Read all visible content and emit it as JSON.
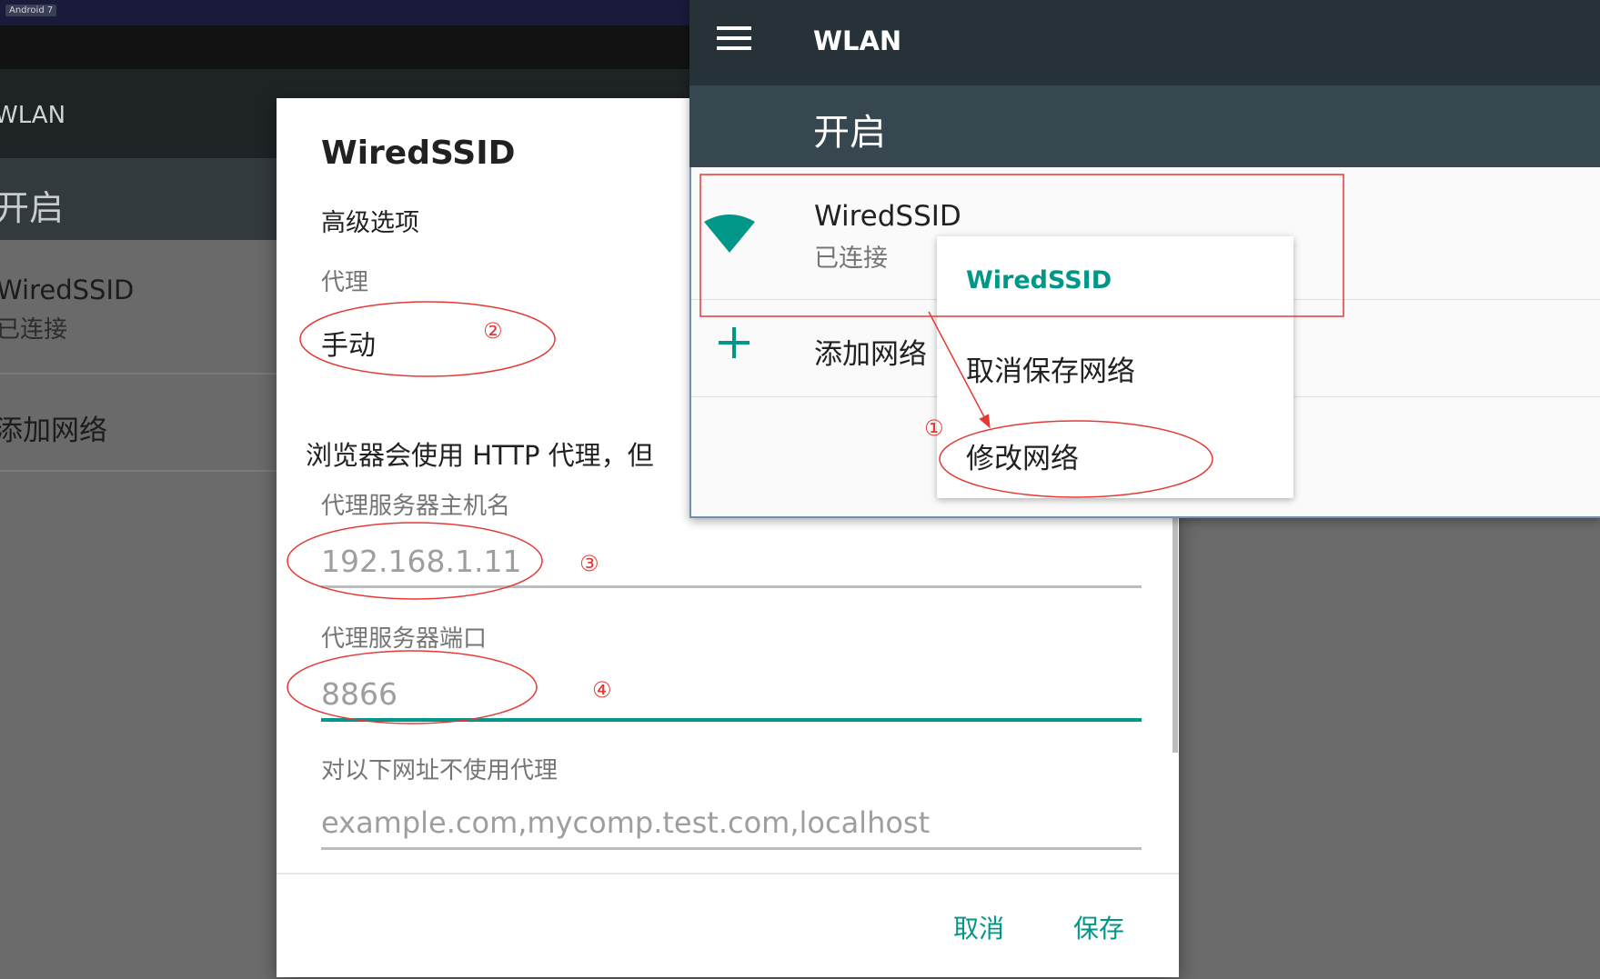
{
  "system": {
    "os_tag": "Android 7"
  },
  "background_screen": {
    "toolbar_title": "WLAN",
    "switch_label": "开启",
    "network": {
      "ssid": "WiredSSID",
      "status": "已连接"
    },
    "add_network_label": "添加网络"
  },
  "dialog": {
    "title": "WiredSSID",
    "advanced_options_label": "高级选项",
    "proxy": {
      "label": "代理",
      "value": "手动"
    },
    "warning_text": "浏览器会使用 HTTP 代理，但",
    "hostname": {
      "label": "代理服务器主机名",
      "placeholder": "192.168.1.11"
    },
    "port": {
      "label": "代理服务器端口",
      "placeholder": "8866"
    },
    "bypass": {
      "label": "对以下网址不使用代理",
      "placeholder": "example.com,mycomp.test.com,localhost"
    },
    "actions": {
      "cancel": "取消",
      "save": "保存"
    }
  },
  "overlay_screen": {
    "toolbar_title": "WLAN",
    "switch_label": "开启",
    "network": {
      "ssid": "WiredSSID",
      "status": "已连接"
    },
    "add_network_label": "添加网络",
    "popup_menu": {
      "title": "WiredSSID",
      "items": [
        "取消保存网络",
        "修改网络"
      ]
    }
  },
  "annotations": {
    "markers": [
      "①",
      "②",
      "③",
      "④"
    ]
  },
  "colors": {
    "accent": "#009688",
    "annotation": "#e53935",
    "toolbar": "#263238",
    "switch_bar": "#37474f"
  }
}
